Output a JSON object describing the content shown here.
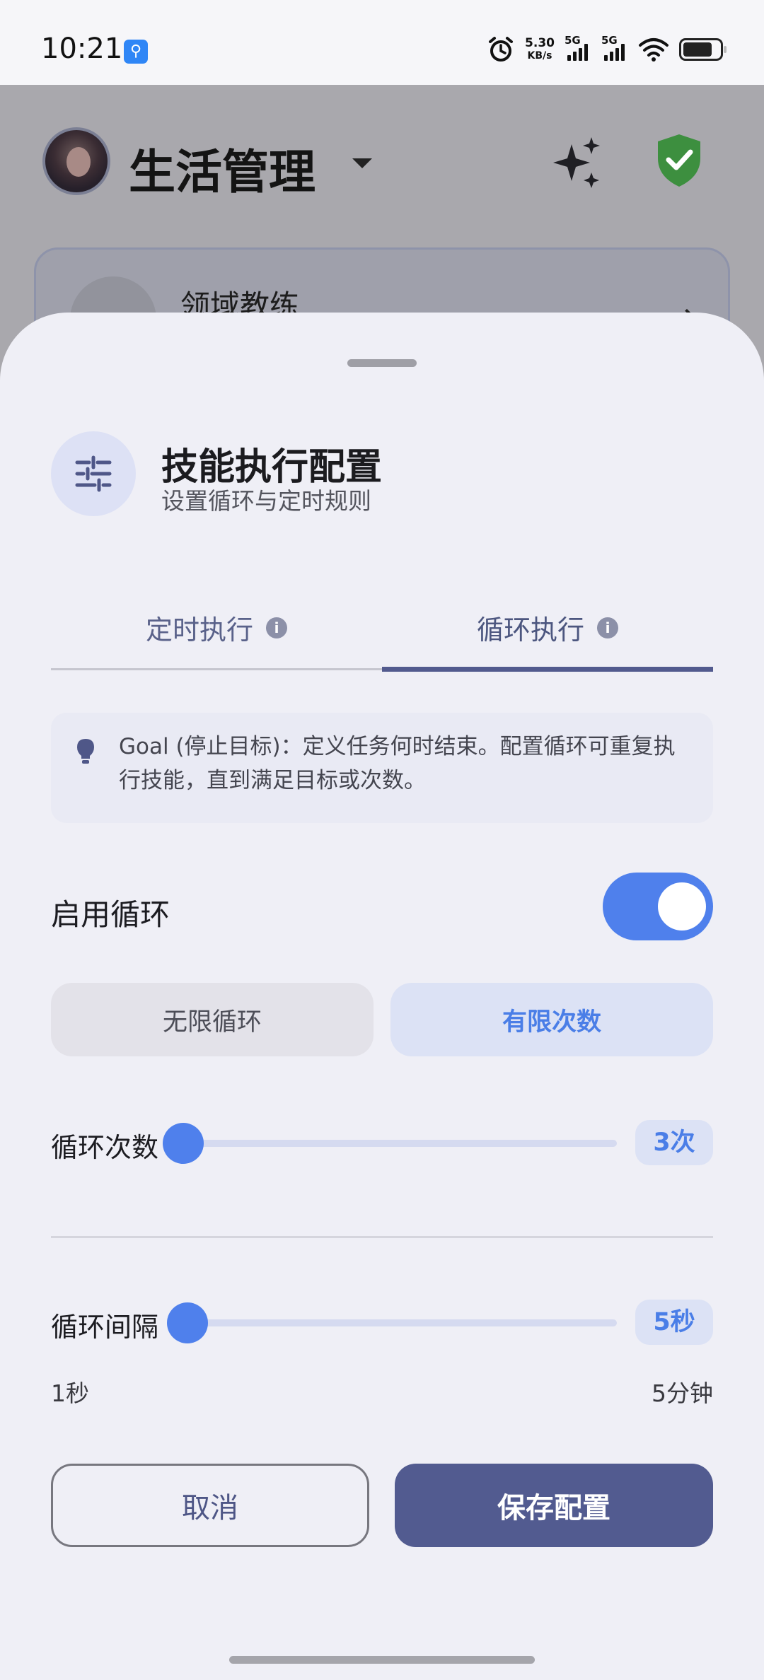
{
  "status_bar": {
    "time": "10:21",
    "net_speed_value": "5.30",
    "net_speed_unit": "KB/s",
    "sim1_label": "5G",
    "sim2_label": "5G"
  },
  "app_header": {
    "title": "生活管理",
    "card_label": "领域教练"
  },
  "sheet": {
    "title": "技能执行配置",
    "subtitle": "设置循环与定时规则",
    "tabs": [
      {
        "label": "定时执行",
        "active": false
      },
      {
        "label": "循环执行",
        "active": true
      }
    ],
    "info_text": "Goal (停止目标)：定义任务何时结束。配置循环可重复执行技能，直到满足目标或次数。",
    "enable_loop_label": "启用循环",
    "enable_loop_on": true,
    "mode_options": [
      "无限循环",
      "有限次数"
    ],
    "selected_mode": "有限次数",
    "loop_count": {
      "label": "循环次数",
      "value_text": "3次",
      "fraction": 0.0
    },
    "loop_interval": {
      "label": "循环间隔",
      "value_text": "5秒",
      "fraction": 0.01,
      "min_label": "1秒",
      "max_label": "5分钟"
    },
    "buttons": {
      "cancel": "取消",
      "save": "保存配置"
    }
  },
  "colors": {
    "accent": "#4f80ec",
    "primary_button": "#525b90",
    "shield": "#3d8f3f"
  },
  "icons": [
    "usb-icon",
    "alarm-icon",
    "wifi-icon",
    "battery-icon",
    "sparkle-icon",
    "shield-check-icon",
    "sliders-icon",
    "info-icon",
    "lightbulb-icon",
    "chevron-right-icon"
  ]
}
